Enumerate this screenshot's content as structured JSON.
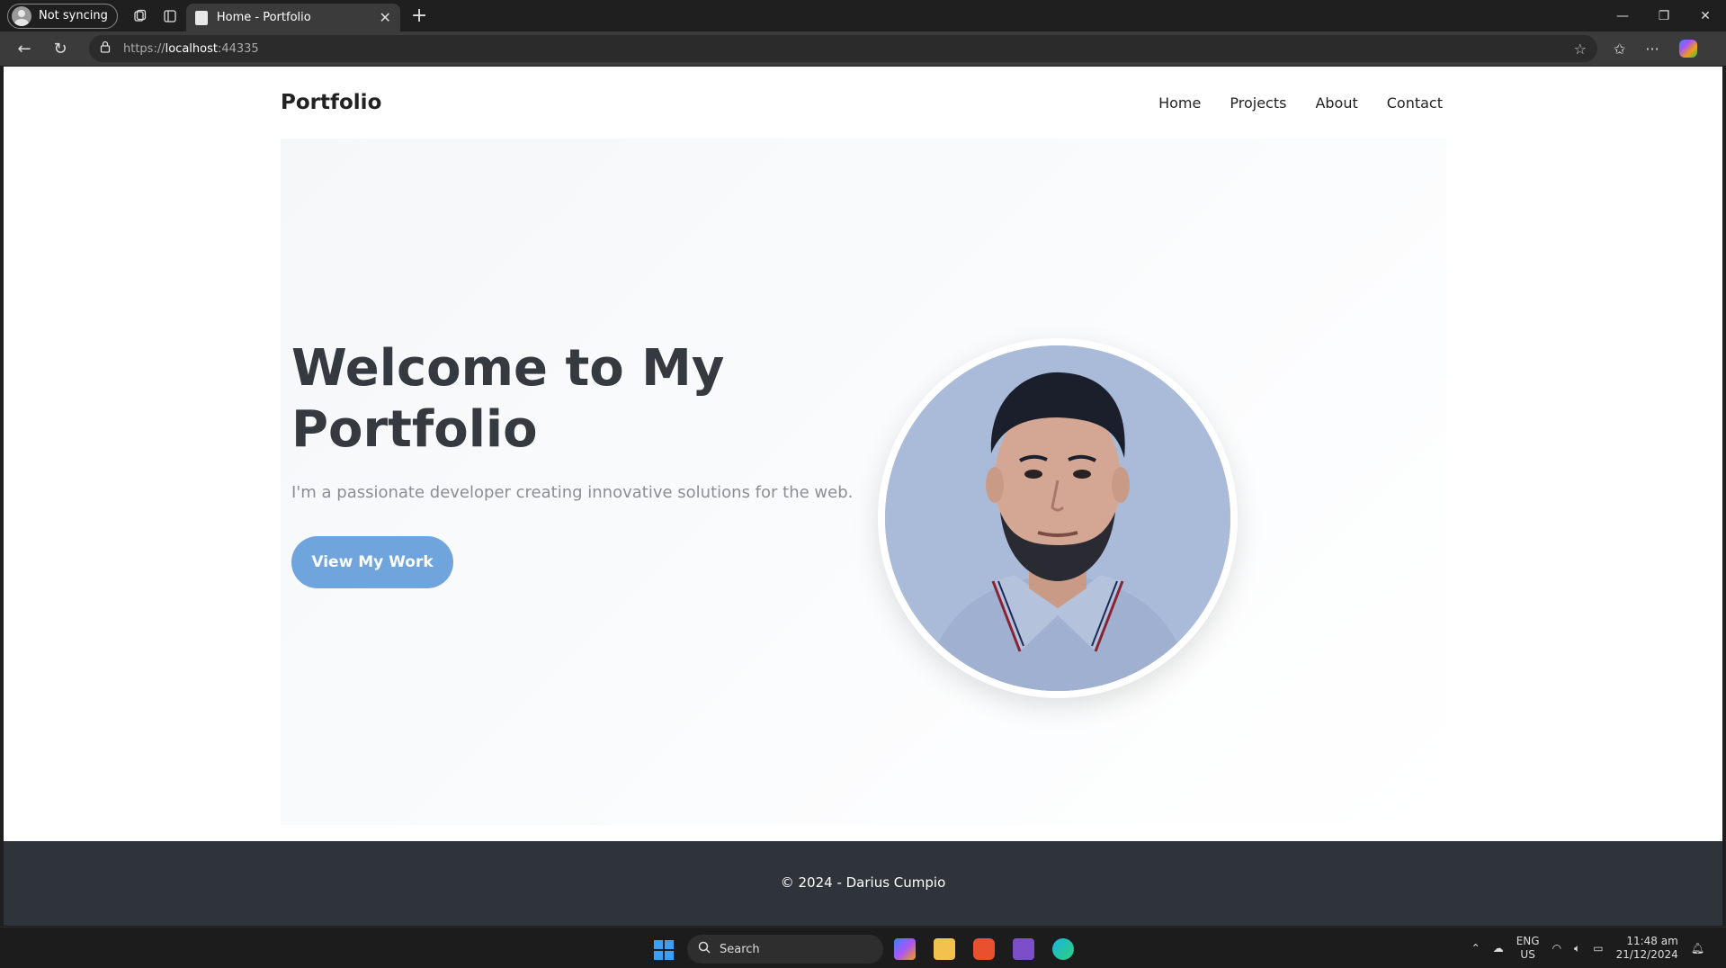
{
  "browser": {
    "profile_label": "Not syncing",
    "tab_title": "Home - Portfolio",
    "url_scheme": "https://",
    "url_host": "localhost",
    "url_port": ":44335"
  },
  "site": {
    "brand": "Portfolio",
    "nav": [
      "Home",
      "Projects",
      "About",
      "Contact"
    ],
    "hero_title": "Welcome to My Portfolio",
    "hero_subtitle": "I'm a passionate developer creating innovative solutions for the web.",
    "cta_label": "View My Work",
    "footer_text": "© 2024 - Darius Cumpio"
  },
  "taskbar": {
    "search_placeholder": "Search",
    "lang_line1": "ENG",
    "lang_line2": "US",
    "time": "11:48 am",
    "date": "21/12/2024"
  },
  "colors": {
    "accent_button": "#6fa4dc",
    "footer_bg": "#2e3439",
    "heading": "#343a40"
  }
}
